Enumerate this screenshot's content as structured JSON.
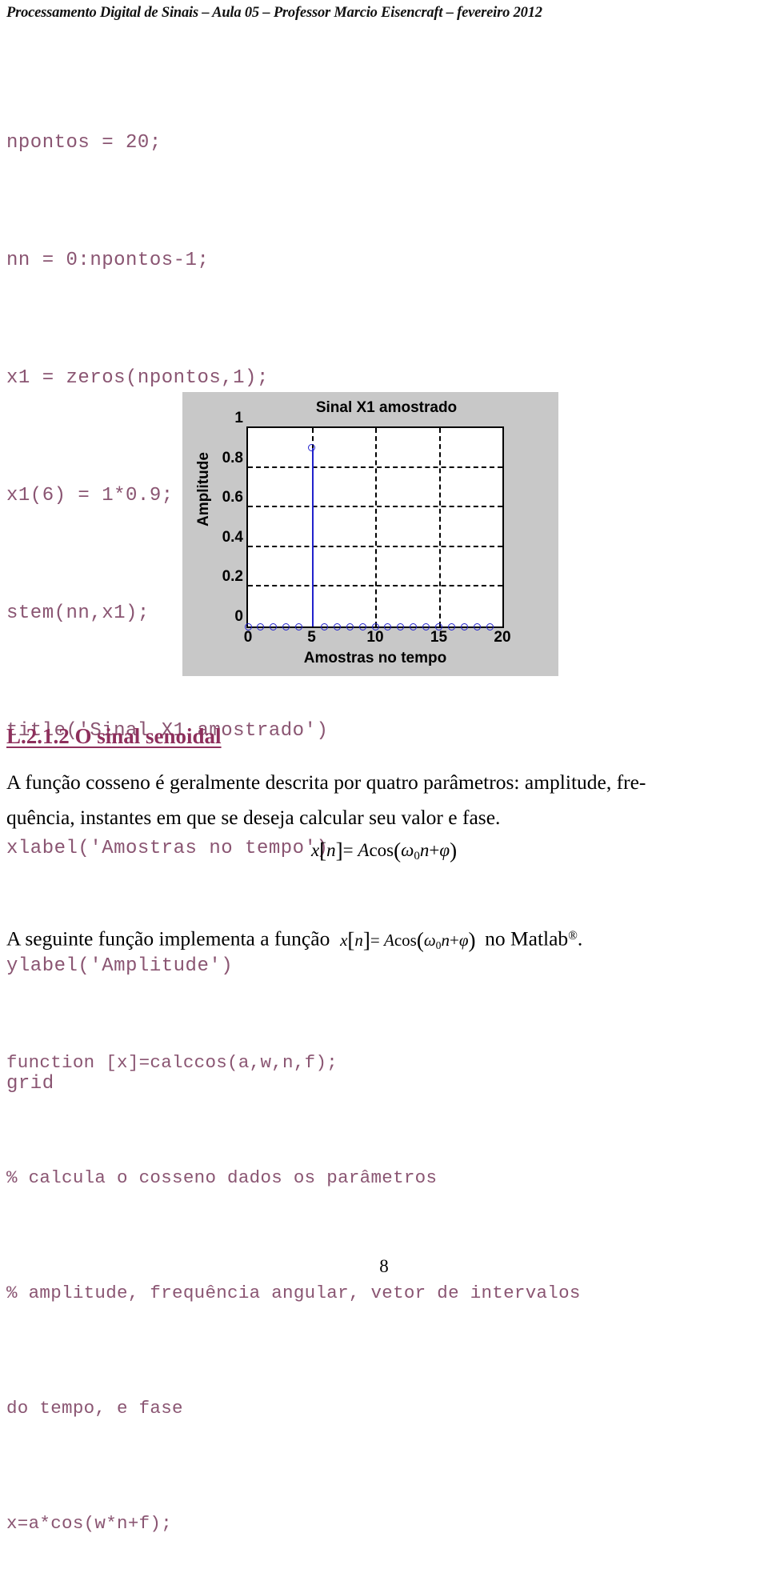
{
  "header": {
    "running_title": "Processamento Digital de Sinais – Aula 05 – Professor Marcio Eisencraft – fevereiro 2012"
  },
  "code_top": {
    "lines": [
      "npontos = 20;",
      "nn = 0:npontos-1;",
      "x1 = zeros(npontos,1);",
      "x1(6) = 1*0.9;",
      "stem(nn,x1);",
      "title('Sinal X1 amostrado')",
      "xlabel('Amostras no tempo')",
      "ylabel('Amplitude')",
      "grid"
    ]
  },
  "figure": {
    "background_color": "#c8c8c8",
    "line_color": "#2222cc"
  },
  "chart_data": {
    "type": "scatter",
    "title": "Sinal X1 amostrado",
    "xlabel": "Amostras no tempo",
    "ylabel": "Amplitude",
    "x": [
      0,
      1,
      2,
      3,
      4,
      5,
      6,
      7,
      8,
      9,
      10,
      11,
      12,
      13,
      14,
      15,
      16,
      17,
      18,
      19
    ],
    "values": [
      0,
      0,
      0,
      0,
      0,
      0.9,
      0,
      0,
      0,
      0,
      0,
      0,
      0,
      0,
      0,
      0,
      0,
      0,
      0,
      0
    ],
    "xlim": [
      0,
      20
    ],
    "ylim": [
      0,
      1
    ],
    "xticks": [
      "0",
      "5",
      "10",
      "15",
      "20"
    ],
    "xtick_values": [
      0,
      5,
      10,
      15,
      20
    ],
    "yticks": [
      "0",
      "0.2",
      "0.4",
      "0.6",
      "0.8",
      "1"
    ],
    "ytick_values": [
      0,
      0.2,
      0.4,
      0.6,
      0.8,
      1
    ],
    "grid": true,
    "legend": "none"
  },
  "section": {
    "heading": "L.2.1.2 O sinal senoidal"
  },
  "paragraphs": {
    "p1": "A função cosseno é geralmente descrita por quatro parâmetros: amplitude, fre-quência, instantes em que se deseja calcular seu valor e fase.",
    "p1_line1": "A função cosseno é geralmente descrita por quatro parâmetros: amplitude, fre-",
    "p1_line2": "quência, instantes em que se deseja calcular seu valor e fase.",
    "p2_before": "A seguinte função implementa a função",
    "p2_after": "no Matlab",
    "p2_end": "."
  },
  "equation": {
    "x": "x",
    "bracket_open": "[",
    "n": "n",
    "bracket_close": "]",
    "equals": "=",
    "amplitude": "A",
    "cos": "cos",
    "paren_open": "(",
    "omega": "ω",
    "omega_sub": "0",
    "n2": "n",
    "plus": "+",
    "phi": "φ",
    "paren_close": ")"
  },
  "code_bottom": {
    "lines": [
      "function [x]=calccos(a,w,n,f);",
      "% calcula o cosseno dados os parâmetros",
      "% amplitude, frequência angular, vetor de intervalos",
      "do tempo, e fase",
      "x=a*cos(w*n+f);"
    ]
  },
  "footer": {
    "page_number": "8"
  }
}
